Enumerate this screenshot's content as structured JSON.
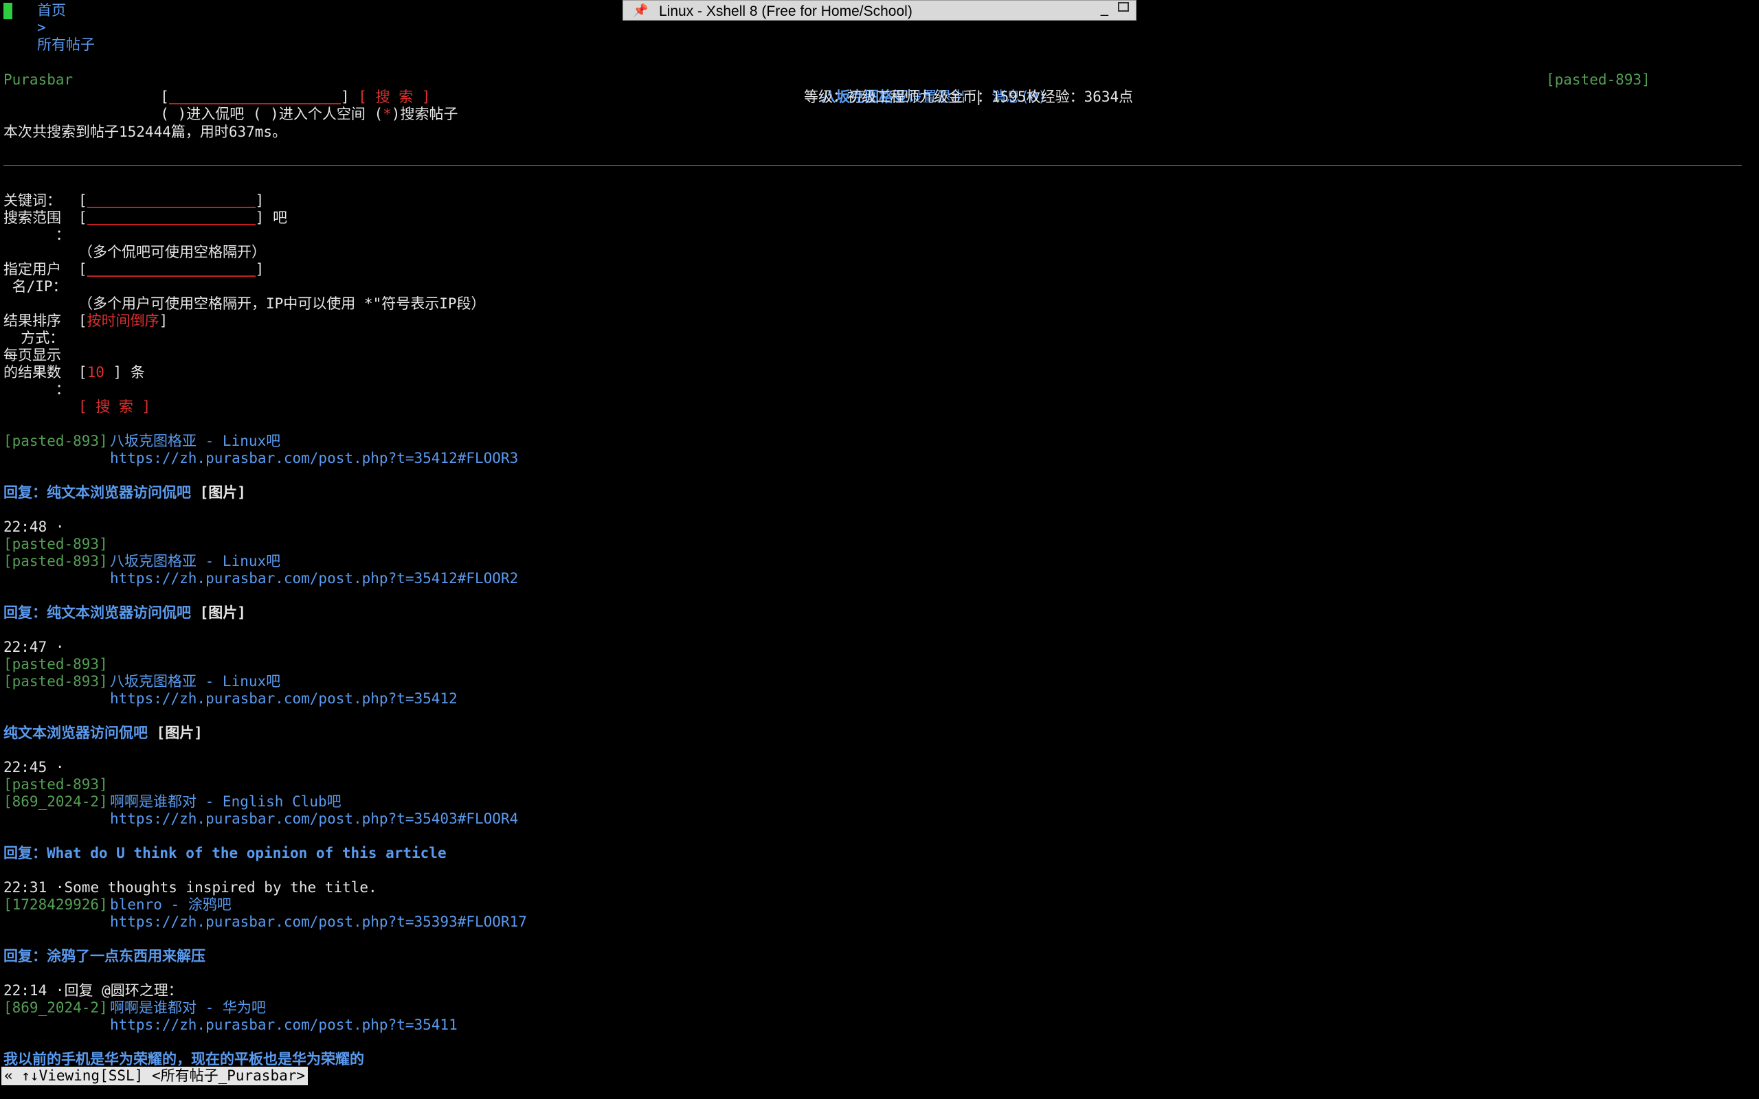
{
  "window": {
    "title": "Linux - Xshell 8 (Free for Home/School)"
  },
  "breadcrumb": {
    "home": "首页",
    "separator": ">",
    "current": "所有帖子"
  },
  "header": {
    "site": "Purasbar",
    "search_open": "[",
    "search_close": "]",
    "search_button": "[ 搜 索 ]",
    "options": {
      "enter_bar": "( )进入侃吧",
      "enter_space": "( )进入个人空间",
      "search_posts_open": "(",
      "search_posts_mark": "*",
      "search_posts_close": ")搜索帖子"
    },
    "user": {
      "name": "八坂克图格亚",
      "settings": "设置",
      "logout": "退出",
      "sep": "|",
      "messages": "消息(0)",
      "stats": "等级：初级工程师九级金币：1595枚经验：3634点"
    },
    "user_tag": "[pasted-893]"
  },
  "summary": "本次共搜索到帖子152444篇，用时637ms。",
  "form": {
    "keyword_label": "关键词：",
    "scope_label_1": "搜索范围",
    "scope_label_2": "      ：",
    "scope_suffix": "吧",
    "scope_hint": "（多个侃吧可使用空格隔开）",
    "user_label_1": "指定用户",
    "user_label_2": " 名/IP：",
    "user_hint": "（多个用户可使用空格隔开，IP中可以使用 *\"符号表示IP段）",
    "sort_label_1": "结果排序",
    "sort_label_2": "  方式：",
    "sort_value": "按时间倒序",
    "per_page_label_1": "每页显示",
    "per_page_label_2": "的结果数",
    "per_page_label_3": "      ：",
    "per_page_value": "10",
    "per_page_suffix": "] 条",
    "submit": "[ 搜 索 ]"
  },
  "results": [
    {
      "prev_tag": "",
      "tag": "[pasted-893]",
      "author": "八坂克图格亚 - Linux吧",
      "url": "https://zh.purasbar.com/post.php?t=35412#FLOOR3",
      "title": "回复：纯文本浏览器访问侃吧",
      "title_extra": " [图片]",
      "time": "22:48 ·",
      "snippet": ""
    },
    {
      "prev_tag": "[pasted-893]",
      "tag": "[pasted-893]",
      "author": "八坂克图格亚 - Linux吧",
      "url": "https://zh.purasbar.com/post.php?t=35412#FLOOR2",
      "title": "回复：纯文本浏览器访问侃吧",
      "title_extra": " [图片]",
      "time": "22:47 ·",
      "snippet": ""
    },
    {
      "prev_tag": "[pasted-893]",
      "tag": "[pasted-893]",
      "author": "八坂克图格亚 - Linux吧",
      "url": "https://zh.purasbar.com/post.php?t=35412",
      "title": "纯文本浏览器访问侃吧",
      "title_extra": " [图片]",
      "time": "22:45 ·",
      "snippet": ""
    },
    {
      "prev_tag": "[pasted-893]",
      "tag": "[869_2024-2]",
      "author": "啊啊是谁都对 - English Club吧",
      "url": "https://zh.purasbar.com/post.php?t=35403#FLOOR4",
      "title": "回复：What do U think of the opinion of this article",
      "title_extra": "",
      "time": "22:31 ·",
      "snippet": "Some thoughts inspired by the title."
    },
    {
      "prev_tag": "",
      "tag": "[1728429926]",
      "author": "blenro - 涂鸦吧",
      "url": "https://zh.purasbar.com/post.php?t=35393#FLOOR17",
      "title": "回复：涂鸦了一点东西用来解压",
      "title_extra": "",
      "time": "22:14 ·",
      "snippet": "回复 @圆环之理："
    },
    {
      "prev_tag": "",
      "tag": "[869_2024-2]",
      "author": "啊啊是谁都对 - 华为吧",
      "url": "https://zh.purasbar.com/post.php?t=35411",
      "title": "我以前的手机是华为荣耀的，现在的平板也是华为荣耀的",
      "title_extra": "",
      "time": "",
      "snippet": ""
    }
  ],
  "status": {
    "arrows": "« ↑↓",
    "text": "Viewing[SSL] <所有帖子_Purasbar>"
  }
}
